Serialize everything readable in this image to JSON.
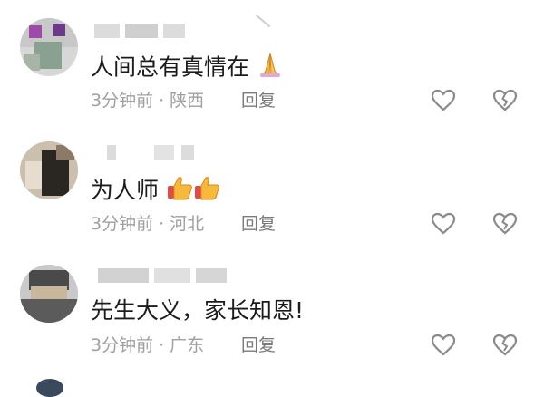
{
  "comments": [
    {
      "text": "人间总有真情在",
      "emoji": "pray",
      "time": "3分钟前",
      "dot": "·",
      "location": "陕西",
      "reply": "回复"
    },
    {
      "text": "为人师",
      "emoji": "thumbs-up-x2",
      "time": "3分钟前",
      "dot": "·",
      "location": "河北",
      "reply": "回复"
    },
    {
      "text": "先生大义，家长知恩!",
      "emoji": "",
      "time": "3分钟前",
      "dot": "·",
      "location": "广东",
      "reply": "回复"
    }
  ],
  "icons": {
    "like": "heart-outline-icon",
    "dislike": "broken-heart-icon"
  },
  "colors": {
    "text": "#1b1b1b",
    "meta": "#a0a0a0",
    "reply": "#7a7a7a",
    "icon": "#8a8a8a"
  }
}
